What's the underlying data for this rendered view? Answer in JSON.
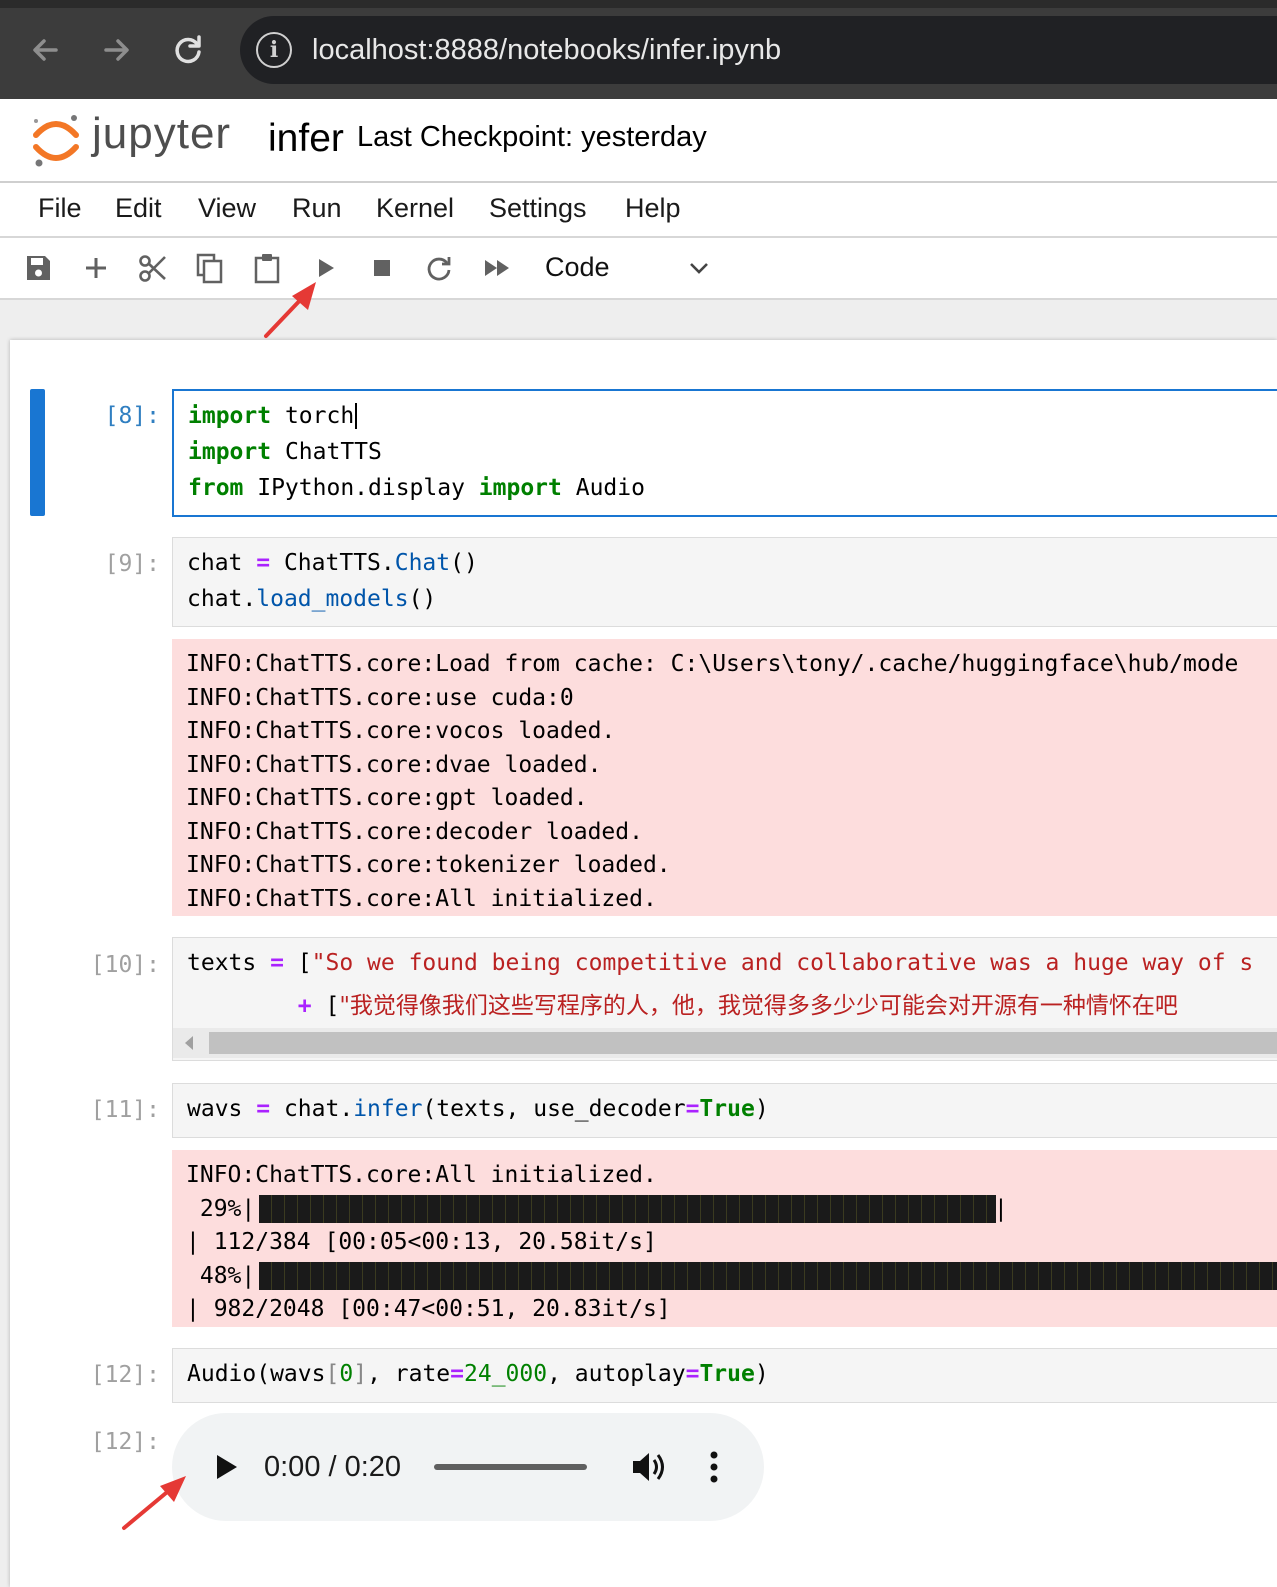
{
  "browser": {
    "url": "localhost:8888/notebooks/infer.ipynb",
    "info_icon": "info-icon",
    "back_icon": "arrow-left-icon",
    "forward_icon": "arrow-right-icon",
    "reload_icon": "reload-icon"
  },
  "header": {
    "logo_text": "jupyter",
    "notebook_name": "infer",
    "checkpoint": "Last Checkpoint: yesterday"
  },
  "menu": [
    "File",
    "Edit",
    "View",
    "Run",
    "Kernel",
    "Settings",
    "Help"
  ],
  "toolbar": {
    "icons": [
      "save-icon",
      "add-icon",
      "cut-icon",
      "copy-icon",
      "paste-icon",
      "run-icon",
      "stop-icon",
      "restart-icon",
      "fast-forward-icon"
    ],
    "cell_type": "Code"
  },
  "cells": {
    "c8": {
      "prompt": "[8]:",
      "line1": {
        "kw": "import",
        "rest": " torch"
      },
      "line2": {
        "kw": "import",
        "rest": " ChatTTS"
      },
      "line3": {
        "kw1": "from",
        "mid": " IPython.display ",
        "kw2": "import",
        "rest": " Audio"
      }
    },
    "c9": {
      "prompt": "[9]:",
      "line1": {
        "a": "chat ",
        "op": "=",
        "b": " ChatTTS.",
        "fn": "Chat",
        "c": "()"
      },
      "line2": {
        "a": "chat.",
        "fn": "load_models",
        "b": "()"
      },
      "output": [
        "INFO:ChatTTS.core:Load from cache: C:\\Users\\tony/.cache/huggingface\\hub/mode",
        "INFO:ChatTTS.core:use cuda:0",
        "INFO:ChatTTS.core:vocos loaded.",
        "INFO:ChatTTS.core:dvae loaded.",
        "INFO:ChatTTS.core:gpt loaded.",
        "INFO:ChatTTS.core:decoder loaded.",
        "INFO:ChatTTS.core:tokenizer loaded.",
        "INFO:ChatTTS.core:All initialized."
      ]
    },
    "c10": {
      "prompt": "[10]:",
      "line1": {
        "a": "texts ",
        "op": "=",
        "b": " [",
        "str": "\"So we found being competitive and collaborative was a huge way of s"
      },
      "line2": {
        "indent": "        ",
        "op": "+",
        "b": " [",
        "str": "\"我觉得像我们这些写程序的人，他，我觉得多多少少可能会对开源有一种情怀在吧"
      }
    },
    "c11": {
      "prompt": "[11]:",
      "line1": {
        "a": "wavs ",
        "op": "=",
        "b": " chat.",
        "fn": "infer",
        "c": "(texts, use_decoder",
        "op2": "=",
        "kw": "True",
        "d": ")"
      },
      "output": {
        "line1": "INFO:ChatTTS.core:All initialized.",
        "bar1_label": " 29%|",
        "bar1_fraction": 0.29,
        "bar1_end": "|",
        "line3": "| 112/384 [00:05<00:13, 20.58it/s]",
        "bar2_label": " 48%|",
        "bar2_fraction": 0.48,
        "line5": "| 982/2048 [00:47<00:51, 20.83it/s]"
      }
    },
    "c12": {
      "prompt": "[12]:",
      "line1": {
        "a": "Audio(wavs",
        "br1": "[",
        "n0": "0",
        "br2": "]",
        "b": ", rate",
        "op": "=",
        "num": "24_000",
        "c": ", autoplay",
        "op2": "=",
        "kw": "True",
        "d": ")"
      },
      "out_prompt": "[12]:",
      "audio": {
        "time": "0:00 / 0:20",
        "play_icon": "play-icon",
        "volume_icon": "volume-icon",
        "menu_icon": "more-vertical-icon"
      }
    }
  },
  "colors": {
    "accent": "#1976d2",
    "stderr_bg": "#fddddd",
    "annotation_arrow": "#e53935"
  }
}
